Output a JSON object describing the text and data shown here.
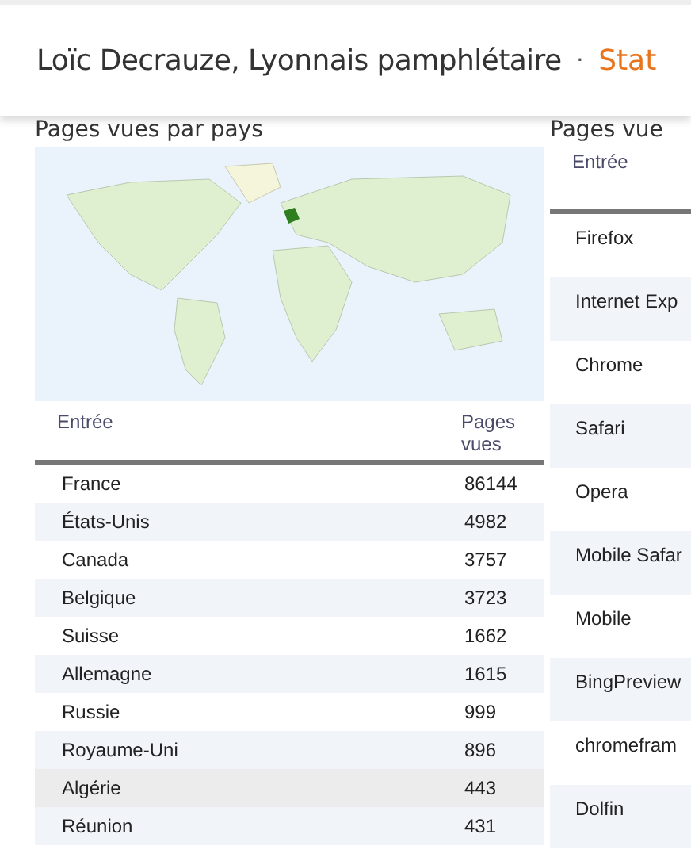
{
  "header": {
    "title": "Loïc Decrauze, Lyonnais pamphlétaire",
    "separator": "·",
    "link": "Stat"
  },
  "countries": {
    "title": "Pages vues par pays",
    "columns": [
      "Entrée",
      "Pages vues"
    ],
    "rows": [
      {
        "name": "France",
        "views": "86144",
        "highlighted": false
      },
      {
        "name": "États-Unis",
        "views": "4982",
        "highlighted": false
      },
      {
        "name": "Canada",
        "views": "3757",
        "highlighted": false
      },
      {
        "name": "Belgique",
        "views": "3723",
        "highlighted": false
      },
      {
        "name": "Suisse",
        "views": "1662",
        "highlighted": false
      },
      {
        "name": "Allemagne",
        "views": "1615",
        "highlighted": false
      },
      {
        "name": "Russie",
        "views": "999",
        "highlighted": false
      },
      {
        "name": "Royaume-Uni",
        "views": "896",
        "highlighted": false
      },
      {
        "name": "Algérie",
        "views": "443",
        "highlighted": true
      },
      {
        "name": "Réunion",
        "views": "431",
        "highlighted": false
      }
    ]
  },
  "browsers": {
    "title": "Pages vue",
    "columns": [
      "Entrée"
    ],
    "rows": [
      "Firefox",
      "Internet Exp",
      "Chrome",
      "Safari",
      "Opera",
      "Mobile Safar",
      "Mobile",
      "BingPreview",
      "chromefram",
      "Dolfin"
    ]
  }
}
